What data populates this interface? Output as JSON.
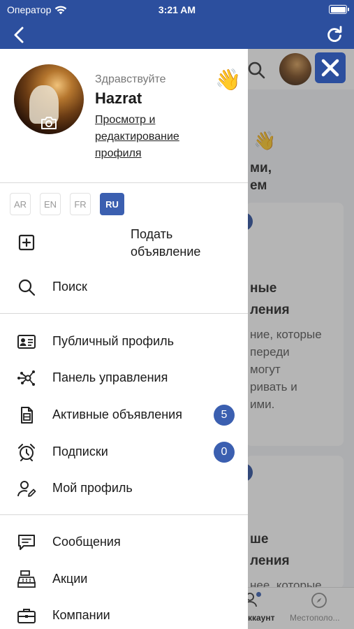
{
  "status": {
    "carrier": "Оператор",
    "time": "3:21 AM"
  },
  "drawer": {
    "greeting": "Здравствуйте",
    "username": "Hazrat",
    "edit_profile_link": "Просмотр и редактирование профиля",
    "languages": [
      {
        "code": "AR",
        "active": false
      },
      {
        "code": "EN",
        "active": false
      },
      {
        "code": "FR",
        "active": false
      },
      {
        "code": "RU",
        "active": true
      }
    ],
    "post_ad": "Подать объявление",
    "search": "Поиск",
    "menu": [
      {
        "label": "Публичный профиль",
        "icon": "id-card-icon"
      },
      {
        "label": "Панель управления",
        "icon": "network-nodes-icon"
      },
      {
        "label": "Активные объявления",
        "icon": "document-icon",
        "badge": "5"
      },
      {
        "label": "Подписки",
        "icon": "alarm-clock-icon",
        "badge": "0"
      },
      {
        "label": "Мой профиль",
        "icon": "user-edit-icon"
      },
      {
        "label": "Сообщения",
        "icon": "chat-icon"
      },
      {
        "label": "Акции",
        "icon": "cash-register-icon"
      },
      {
        "label": "Компании",
        "icon": "briefcase-icon"
      }
    ]
  },
  "background": {
    "line1": "ми,",
    "line2": "ем",
    "heading1a": "ные",
    "heading1b": "ления",
    "para1a": "ние, которые",
    "para1b": "переди",
    "para1c": "могут",
    "para1d": "ривать и",
    "para1e": "ими.",
    "heading2a": "ше",
    "heading2b": "ления",
    "para2a": "нее, которые",
    "tab_account": "ккаунт",
    "tab_location": "Местополо..."
  }
}
